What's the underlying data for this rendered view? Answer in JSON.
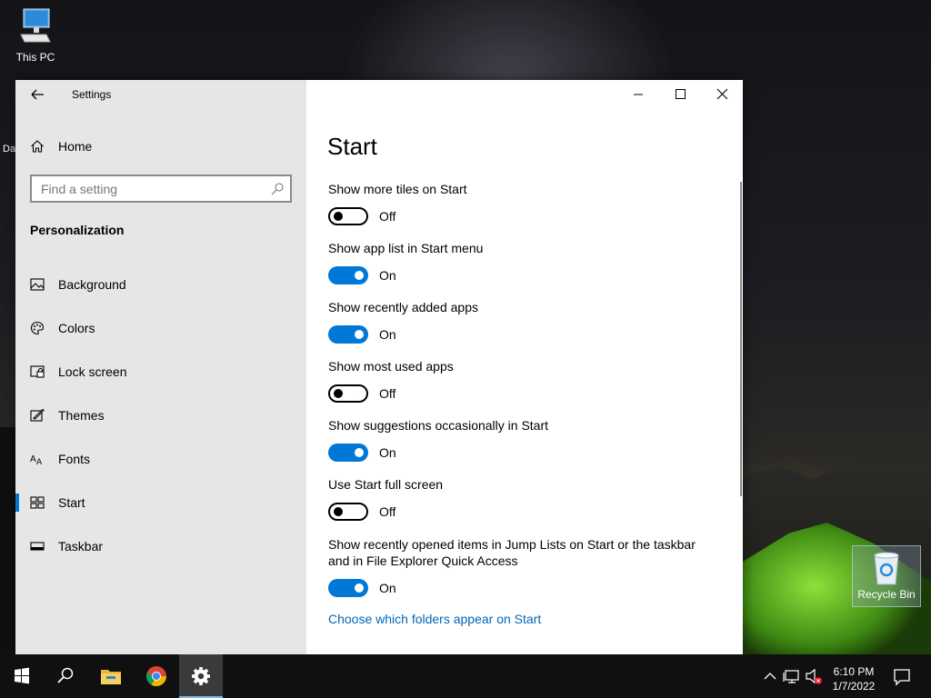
{
  "desktop": {
    "icons": [
      {
        "label": "This PC"
      },
      {
        "label": "Recycle Bin"
      }
    ],
    "partial_label": "Da"
  },
  "window": {
    "app_title": "Settings",
    "controls": [
      "minimize-icon",
      "maximize-icon",
      "close-icon"
    ]
  },
  "sidebar": {
    "home_label": "Home",
    "search_placeholder": "Find a setting",
    "section_title": "Personalization",
    "items": [
      {
        "label": "Background",
        "icon": "background-icon"
      },
      {
        "label": "Colors",
        "icon": "palette-icon"
      },
      {
        "label": "Lock screen",
        "icon": "lock-screen-icon"
      },
      {
        "label": "Themes",
        "icon": "themes-icon"
      },
      {
        "label": "Fonts",
        "icon": "fonts-icon"
      },
      {
        "label": "Start",
        "icon": "start-icon",
        "selected": true
      },
      {
        "label": "Taskbar",
        "icon": "taskbar-icon"
      }
    ]
  },
  "main": {
    "title": "Start",
    "settings": [
      {
        "label": "Show more tiles on Start",
        "on": false,
        "state": "Off"
      },
      {
        "label": "Show app list in Start menu",
        "on": true,
        "state": "On"
      },
      {
        "label": "Show recently added apps",
        "on": true,
        "state": "On"
      },
      {
        "label": "Show most used apps",
        "on": false,
        "state": "Off"
      },
      {
        "label": "Show suggestions occasionally in Start",
        "on": true,
        "state": "On"
      },
      {
        "label": "Use Start full screen",
        "on": false,
        "state": "Off"
      },
      {
        "label": "Show recently opened items in Jump Lists on Start or the taskbar and in File Explorer Quick Access",
        "on": true,
        "state": "On"
      }
    ],
    "link_text": "Choose which folders appear on Start"
  },
  "taskbar": {
    "buttons": [
      "windows-start-icon",
      "search-icon",
      "file-explorer-icon",
      "chrome-icon",
      "settings-gear-icon"
    ],
    "active": "settings-gear-icon",
    "tray": [
      "chevron-up-icon",
      "network-icon",
      "volume-muted-icon"
    ],
    "time": "6:10 PM",
    "date": "1/7/2022",
    "notification_icon": "action-center-icon"
  },
  "colors": {
    "accent": "#0078d7",
    "link": "#0067b8",
    "sidebar_bg": "#e6e6e6",
    "taskbar_bg": "#101010"
  }
}
